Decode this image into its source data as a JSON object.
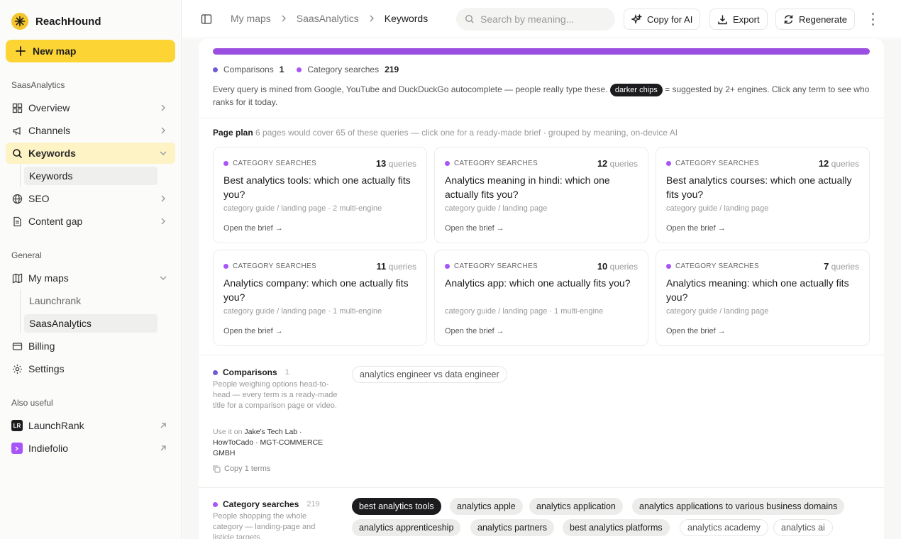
{
  "app": {
    "name": "ReachHound"
  },
  "sidebar": {
    "new_map": "New map",
    "section_project": "SaasAnalytics",
    "section_general": "General",
    "section_also": "Also useful",
    "overview": "Overview",
    "channels": "Channels",
    "keywords": "Keywords",
    "keywords_sub": "Keywords",
    "seo": "SEO",
    "content_gap": "Content gap",
    "my_maps": "My maps",
    "maps": [
      "Launchrank",
      "SaasAnalytics"
    ],
    "billing": "Billing",
    "settings": "Settings",
    "launchrank": "LaunchRank",
    "launchrank_badge": "LR",
    "indiefolio": "Indiefolio"
  },
  "topbar": {
    "crumbs": [
      "My maps",
      "SaasAnalytics",
      "Keywords"
    ],
    "search_placeholder": "Search by meaning...",
    "copy_ai": "Copy for AI",
    "export": "Export",
    "regenerate": "Regenerate"
  },
  "legend": [
    {
      "label": "Comparisons",
      "count": "1",
      "color": "#6b5bd8"
    },
    {
      "label": "Category searches",
      "count": "219",
      "color": "#a855f7"
    }
  ],
  "intro": {
    "text1": "Every query is mined from Google, YouTube and DuckDuckGo autocomplete — people really type these.",
    "chip": "darker chips",
    "text2": "= suggested by 2+ engines. Click any term to see who ranks for it today."
  },
  "plan": {
    "title": "Page plan",
    "subtitle": "6 pages would cover 65 of these queries — click one for a ready-made brief · grouped by meaning, on-device AI",
    "queries_word": "queries",
    "open_brief": "Open the brief →",
    "cards": [
      {
        "category": "CATEGORY SEARCHES",
        "count": "13",
        "title": "Best analytics tools: which one actually fits you?",
        "meta": "category guide / landing page · 2 multi-engine"
      },
      {
        "category": "CATEGORY SEARCHES",
        "count": "12",
        "title": "Analytics meaning in hindi: which one actually fits you?",
        "meta": "category guide / landing page"
      },
      {
        "category": "CATEGORY SEARCHES",
        "count": "12",
        "title": "Best analytics courses: which one actually fits you?",
        "meta": "category guide / landing page"
      },
      {
        "category": "CATEGORY SEARCHES",
        "count": "11",
        "title": "Analytics company: which one actually fits you?",
        "meta": "category guide / landing page · 1 multi-engine"
      },
      {
        "category": "CATEGORY SEARCHES",
        "count": "10",
        "title": "Analytics app: which one actually fits you?",
        "meta": "category guide / landing page · 1 multi-engine"
      },
      {
        "category": "CATEGORY SEARCHES",
        "count": "7",
        "title": "Analytics meaning: which one actually fits you?",
        "meta": "category guide / landing page"
      }
    ]
  },
  "groups": {
    "comparisons": {
      "title": "Comparisons",
      "count": "1",
      "desc": "People weighing options head-to-head — every term is a ready-made title for a comparison page or video.",
      "use_prefix": "Use it on",
      "use_sites": "Jake's Tech Lab · HowToCado · MGT-COMMERCE GMBH",
      "copy": "Copy 1 terms",
      "chips": [
        "analytics engineer vs data engineer"
      ]
    },
    "category": {
      "title": "Category searches",
      "count": "219",
      "desc": "People shopping the whole category — landing-page and listicle targets.",
      "chips": [
        "best analytics tools",
        "analytics apple",
        "analytics application",
        "analytics applications to various business domains",
        "analytics apprenticeship",
        "analytics partners",
        "best analytics platforms",
        "analytics academy",
        "analytics ai"
      ]
    }
  },
  "colors": {
    "accent": "#fcd535",
    "purple": "#9b4fe0",
    "comparisons": "#6b5bd8",
    "category": "#a855f7"
  }
}
